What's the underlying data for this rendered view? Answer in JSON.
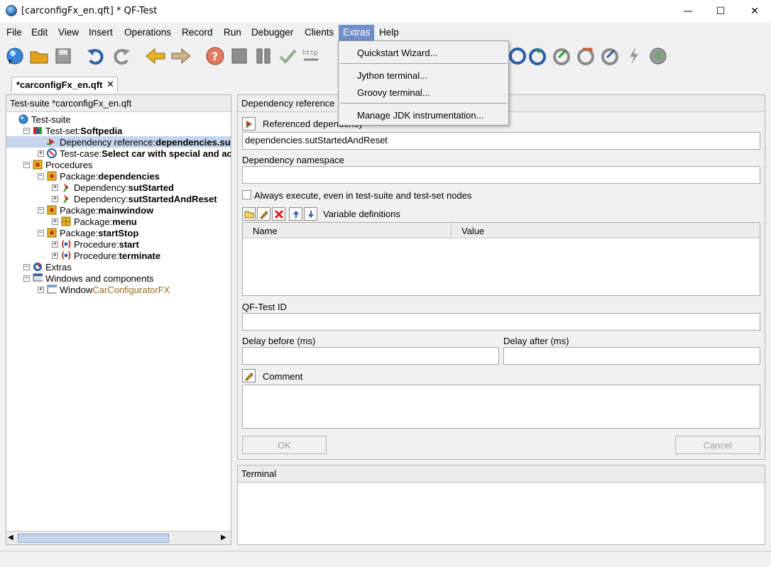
{
  "window": {
    "title": "[carconfigFx_en.qft] * QF-Test",
    "minimize_glyph": "—",
    "maximize_glyph": "☐",
    "close_glyph": "✕"
  },
  "menubar": [
    "File",
    "Edit",
    "View",
    "Insert",
    "Operations",
    "Record",
    "Run",
    "Debugger",
    "Clients",
    "Extras",
    "Help"
  ],
  "extras_menu": {
    "items": [
      "Quickstart Wizard...",
      "Jython terminal...",
      "Groovy terminal...",
      "Manage JDK instrumentation..."
    ]
  },
  "toolbar": {
    "icons": [
      "new-suite-icon",
      "open-icon",
      "save-icon",
      "undo-icon",
      "redo-icon",
      "back-icon",
      "forward-icon",
      "help-icon",
      "stop-icon",
      "pause-icon",
      "check-icon",
      "http-icon",
      "run-icon",
      "step-in-icon",
      "step-over-icon",
      "step-out-icon",
      "skip-icon",
      "continue-icon",
      "breakpoint-icon"
    ]
  },
  "tab": {
    "label": "*carconfigFx_en.qft",
    "close": "✕"
  },
  "tree": {
    "header": "Test-suite *carconfigFx_en.qft",
    "nodes": [
      {
        "indent": 0,
        "toggle": "",
        "icon": "test-suite-icon",
        "prefix": "Test-suite",
        "name": "",
        "selected": false
      },
      {
        "indent": 1,
        "toggle": "−",
        "icon": "test-set-icon",
        "prefix": "Test-set: ",
        "name": "Softpedia",
        "selected": false
      },
      {
        "indent": 2,
        "toggle": "",
        "icon": "dependency-reference-icon",
        "prefix": "Dependency reference: ",
        "name": "dependencies.sutStartedAndReset",
        "selected": true
      },
      {
        "indent": 2,
        "toggle": "+",
        "icon": "test-case-icon",
        "prefix": "Test-case: ",
        "name": "Select car with special and accessories",
        "selected": false
      },
      {
        "indent": 1,
        "toggle": "−",
        "icon": "procedures-icon",
        "prefix": "Procedures",
        "name": "",
        "selected": false
      },
      {
        "indent": 2,
        "toggle": "−",
        "icon": "package-icon",
        "prefix": "Package: ",
        "name": "dependencies",
        "selected": false
      },
      {
        "indent": 3,
        "toggle": "+",
        "icon": "dependency-icon",
        "prefix": "Dependency: ",
        "name": "sutStarted",
        "selected": false
      },
      {
        "indent": 3,
        "toggle": "+",
        "icon": "dependency-icon",
        "prefix": "Dependency: ",
        "name": "sutStartedAndReset",
        "selected": false
      },
      {
        "indent": 2,
        "toggle": "−",
        "icon": "package-icon",
        "prefix": "Package: ",
        "name": "mainwindow",
        "selected": false
      },
      {
        "indent": 3,
        "toggle": "+",
        "icon": "package-grid-icon",
        "prefix": "Package: ",
        "name": "menu",
        "selected": false
      },
      {
        "indent": 2,
        "toggle": "−",
        "icon": "package-icon",
        "prefix": "Package: ",
        "name": "startStop",
        "selected": false
      },
      {
        "indent": 3,
        "toggle": "+",
        "icon": "procedure-icon",
        "prefix": "Procedure: ",
        "name": "start",
        "selected": false
      },
      {
        "indent": 3,
        "toggle": "+",
        "icon": "procedure-icon",
        "prefix": "Procedure: ",
        "name": "terminate",
        "selected": false
      },
      {
        "indent": 1,
        "toggle": "−",
        "icon": "extras-icon",
        "prefix": "Extras",
        "name": "",
        "selected": false
      },
      {
        "indent": 1,
        "toggle": "−",
        "icon": "windows-components-icon",
        "prefix": "Windows and components",
        "name": "",
        "selected": false
      },
      {
        "indent": 2,
        "toggle": "+",
        "icon": "window-icon",
        "prefix": "Window ",
        "name": "CarConfiguratorFX",
        "selected": false,
        "name_color": "#9a6a1a",
        "name_bold": false
      }
    ]
  },
  "detail": {
    "header": "Dependency reference",
    "referenced_dependency_label": "Referenced dependency",
    "referenced_dependency_value": "dependencies.sutStartedAndReset",
    "namespace_label": "Dependency namespace",
    "namespace_value": "",
    "always_execute_label": "Always execute, even in test-suite and test-set nodes",
    "variable_definitions_label": "Variable definitions",
    "columns": [
      "Name",
      "Value"
    ],
    "qftest_id_label": "QF-Test ID",
    "qftest_id_value": "",
    "delay_before_label": "Delay before (ms)",
    "delay_before_value": "",
    "delay_after_label": "Delay after (ms)",
    "delay_after_value": "",
    "comment_label": "Comment",
    "comment_value": "",
    "ok_label": "OK",
    "cancel_label": "Cancel"
  },
  "terminal": {
    "header": "Terminal"
  },
  "colors": {
    "menu_active": "#6f8fc8",
    "selection": "#c4d4ec",
    "window_name": "#9a6a1a"
  }
}
